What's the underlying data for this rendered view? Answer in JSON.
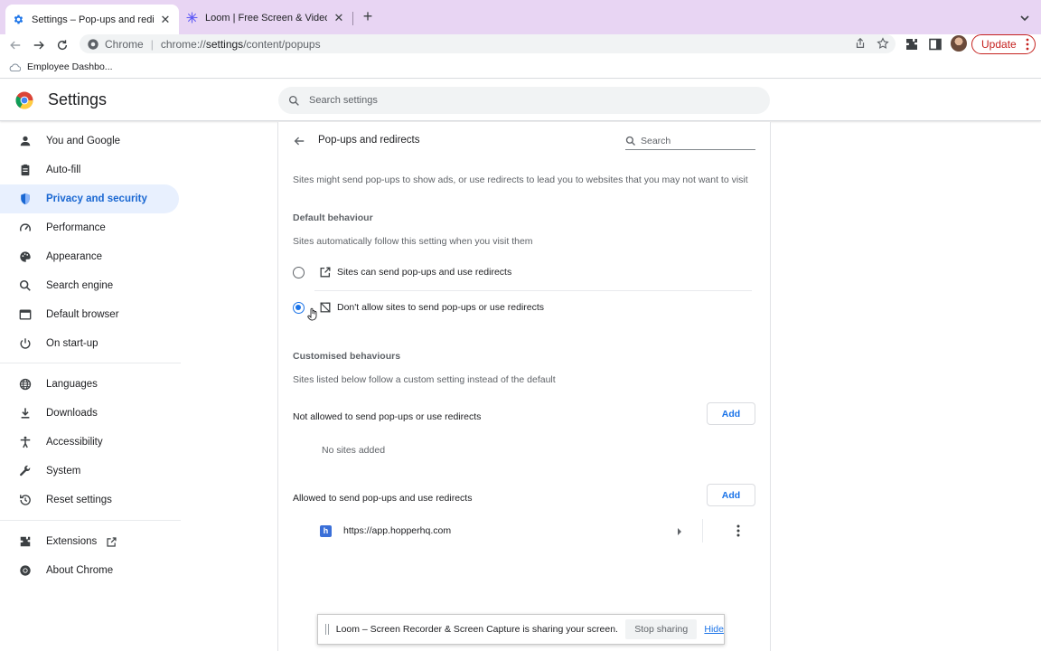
{
  "browser": {
    "tabs": [
      {
        "title": "Settings – Pop-ups and redirects",
        "active": true,
        "favicon": "gear-icon"
      },
      {
        "title": "Loom | Free Screen & Video Recording",
        "active": false,
        "favicon": "loom-icon"
      }
    ],
    "new_tab": "+",
    "omnibox": {
      "chip": "Chrome",
      "url_scheme": "chrome://",
      "url_host": "settings",
      "url_path": "/content/popups"
    },
    "update_label": "Update",
    "bookmarks": [
      {
        "label": "Employee Dashbo..."
      }
    ]
  },
  "settings": {
    "title": "Settings",
    "search_placeholder": "Search settings",
    "nav": [
      {
        "label": "You and Google",
        "icon": "person-icon"
      },
      {
        "label": "Auto-fill",
        "icon": "clipboard-icon"
      },
      {
        "label": "Privacy and security",
        "icon": "shield-icon",
        "selected": true
      },
      {
        "label": "Performance",
        "icon": "speedometer-icon"
      },
      {
        "label": "Appearance",
        "icon": "palette-icon"
      },
      {
        "label": "Search engine",
        "icon": "search-icon"
      },
      {
        "label": "Default browser",
        "icon": "browser-window-icon"
      },
      {
        "label": "On start-up",
        "icon": "power-icon"
      },
      {
        "label": "Languages",
        "icon": "globe-icon"
      },
      {
        "label": "Downloads",
        "icon": "download-icon"
      },
      {
        "label": "Accessibility",
        "icon": "accessibility-icon"
      },
      {
        "label": "System",
        "icon": "wrench-icon"
      },
      {
        "label": "Reset settings",
        "icon": "history-icon"
      },
      {
        "label": "Extensions",
        "icon": "puzzle-icon"
      },
      {
        "label": "About Chrome",
        "icon": "chrome-icon"
      }
    ]
  },
  "popups": {
    "title": "Pop-ups and redirects",
    "search_placeholder": "Search",
    "description": "Sites might send pop-ups to show ads, or use redirects to lead you to websites that you may not want to visit",
    "default_heading": "Default behaviour",
    "default_desc": "Sites automatically follow this setting when you visit them",
    "options": [
      {
        "label": "Sites can send pop-ups and use redirects",
        "checked": false
      },
      {
        "label": "Don't allow sites to send pop-ups or use redirects",
        "checked": true
      }
    ],
    "custom_heading": "Customised behaviours",
    "custom_desc": "Sites listed below follow a custom setting instead of the default",
    "not_allowed_label": "Not allowed to send pop-ups or use redirects",
    "add_label": "Add",
    "no_sites": "No sites added",
    "allowed_label": "Allowed to send pop-ups and use redirects",
    "allowed_sites": [
      {
        "url": "https://app.hopperhq.com",
        "favicon_letter": "h"
      }
    ]
  },
  "loom": {
    "message": "Loom – Screen Recorder & Screen Capture is sharing your screen.",
    "stop_label": "Stop sharing",
    "hide_label": "Hide"
  },
  "colors": {
    "tabstrip": "#e8d5f3",
    "accent": "#1a73e8",
    "selected_nav_bg": "#e8f0fe",
    "update": "#c5221f"
  }
}
